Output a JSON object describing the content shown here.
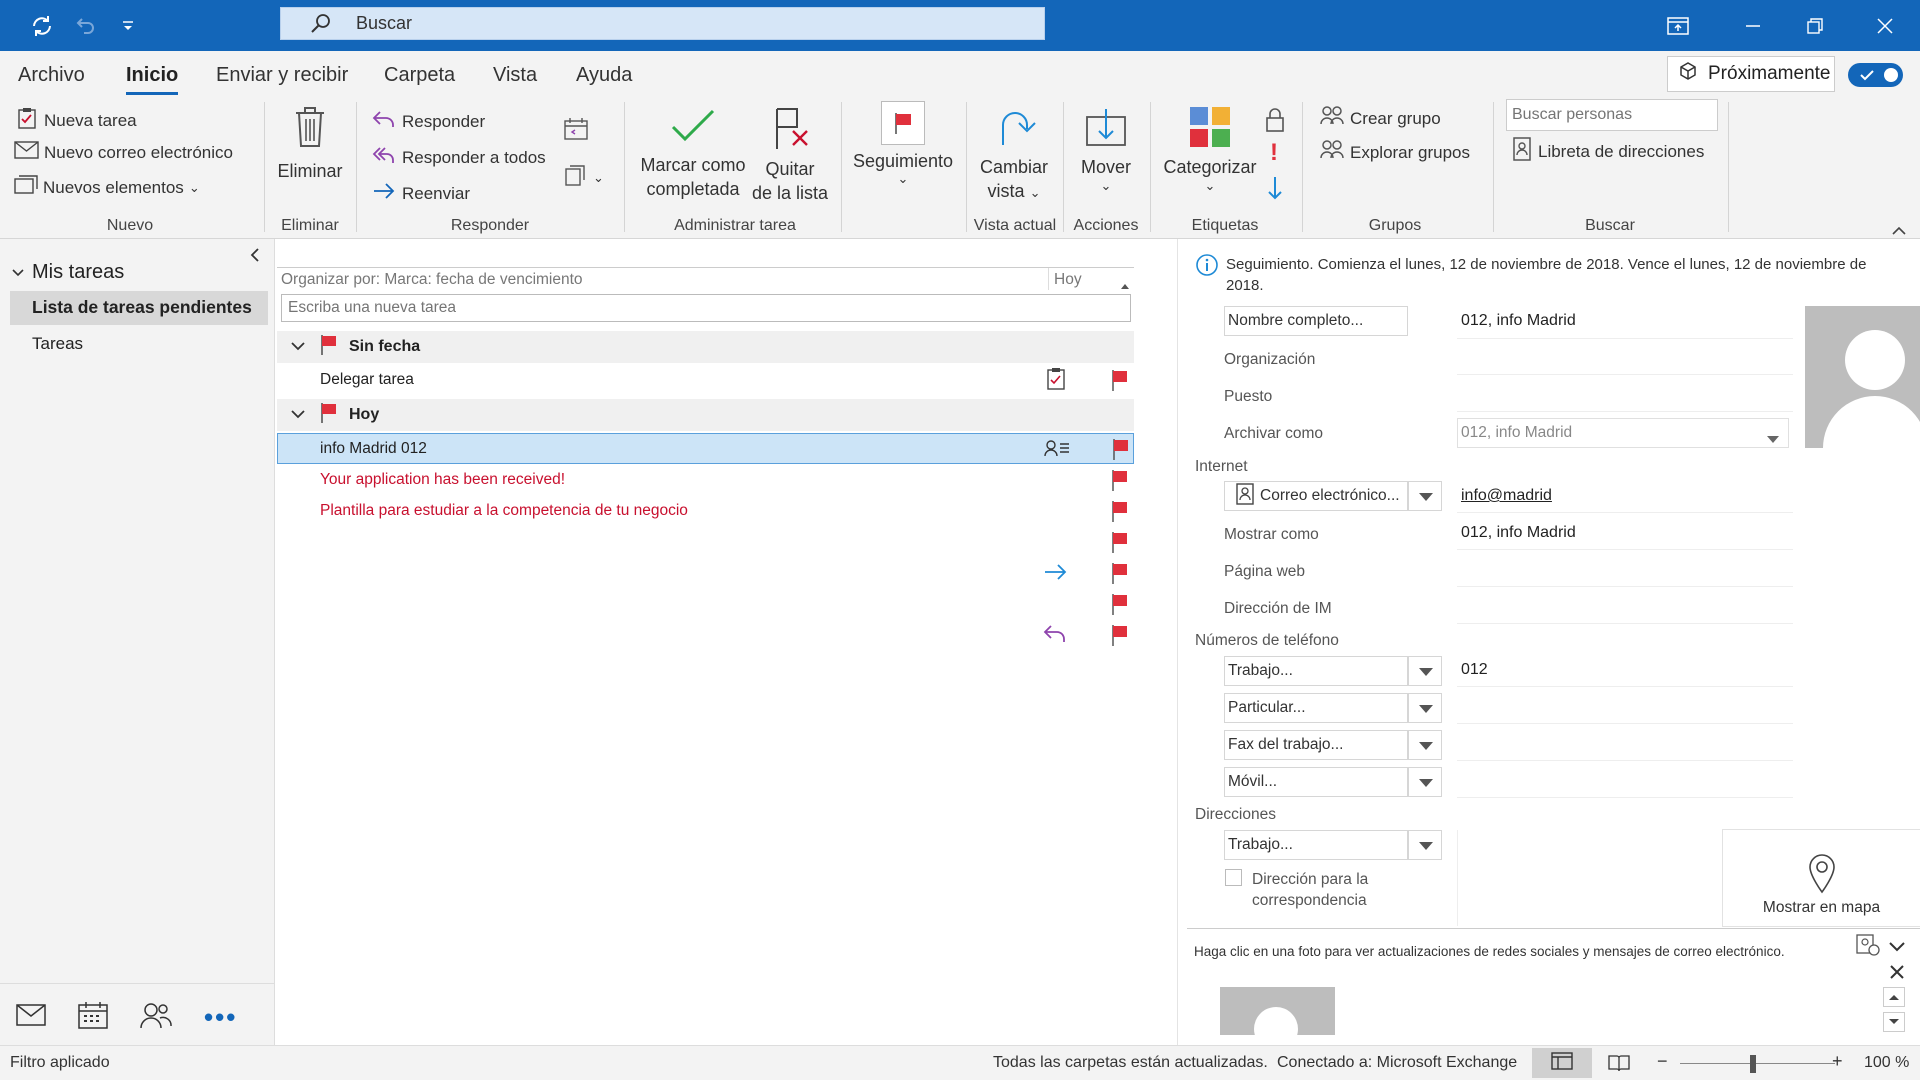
{
  "search": {
    "placeholder": "Buscar"
  },
  "menu": {
    "items": [
      "Archivo",
      "Inicio",
      "Enviar y recibir",
      "Carpeta",
      "Vista",
      "Ayuda"
    ],
    "active": "Inicio",
    "proximamente": "Próximamente"
  },
  "ribbon": {
    "nuevo": {
      "items": [
        "Nueva tarea",
        "Nuevo correo electrónico",
        "Nuevos elementos"
      ],
      "group": "Nuevo"
    },
    "eliminar": {
      "label": "Eliminar",
      "group": "Eliminar"
    },
    "responder": {
      "items": [
        "Responder",
        "Responder a todos",
        "Reenviar"
      ],
      "group": "Responder"
    },
    "admin": {
      "marcar": [
        "Marcar como",
        "completada"
      ],
      "quitar": [
        "Quitar",
        "de la lista"
      ],
      "group": "Administrar tarea"
    },
    "seguimiento": {
      "label": "Seguimiento"
    },
    "vista": {
      "label": [
        "Cambiar",
        "vista"
      ],
      "group": "Vista actual"
    },
    "acciones": {
      "label": "Mover",
      "group": "Acciones"
    },
    "etiquetas": {
      "label": "Categorizar",
      "group": "Etiquetas"
    },
    "grupos": {
      "items": [
        "Crear grupo",
        "Explorar grupos"
      ],
      "group": "Grupos"
    },
    "buscar": {
      "placeholder": "Buscar personas",
      "libreta": "Libreta de direcciones",
      "group": "Buscar"
    }
  },
  "nav": {
    "header": "Mis tareas",
    "items": [
      "Lista de tareas pendientes",
      "Tareas"
    ]
  },
  "tasks": {
    "arrange": "Organizar por: Marca: fecha de vencimiento",
    "today": "Hoy",
    "new_placeholder": "Escriba una nueva tarea",
    "groups": [
      {
        "label": "Sin fecha"
      },
      {
        "label": "Hoy"
      }
    ],
    "items": [
      "Delegar tarea",
      "info Madrid 012",
      "Your application has been received!",
      "Plantilla para estudiar a la competencia de tu negocio"
    ]
  },
  "contact": {
    "info": "Seguimiento.  Comienza el lunes, 12 de noviembre de 2018.  Vence el lunes, 12 de noviembre de 2018.",
    "full_name_btn": "Nombre completo...",
    "full_name": "012, info Madrid",
    "organizacion": "Organización",
    "puesto": "Puesto",
    "archivar_como": "Archivar como",
    "archivar_val": "012, info Madrid",
    "internet": "Internet",
    "email_btn": "Correo electrónico...",
    "email": "info@madrid",
    "mostrar_como": "Mostrar como",
    "mostrar_val": "012, info Madrid",
    "pagina_web": "Página web",
    "direccion_im": "Dirección de IM",
    "telefonos": "Números de teléfono",
    "phones": [
      {
        "label": "Trabajo...",
        "value": "012"
      },
      {
        "label": "Particular...",
        "value": ""
      },
      {
        "label": "Fax del trabajo...",
        "value": ""
      },
      {
        "label": "Móvil...",
        "value": ""
      }
    ],
    "direcciones": "Direcciones",
    "dir_trabajo": "Trabajo...",
    "correspondencia": [
      "Dirección para la",
      "correspondencia"
    ],
    "mapa": "Mostrar en mapa",
    "social": "Haga clic en una foto para ver actualizaciones de redes sociales y mensajes de correo electrónico."
  },
  "status": {
    "left": "Filtro aplicado",
    "updated": "Todas las carpetas están actualizadas.",
    "connected": "Conectado a: Microsoft Exchange",
    "zoom": "100 %"
  },
  "colors": {
    "accent": "#1366b9",
    "flag": "#e0303c",
    "selected": "#cce4f7",
    "red_text": "#c8102e"
  }
}
